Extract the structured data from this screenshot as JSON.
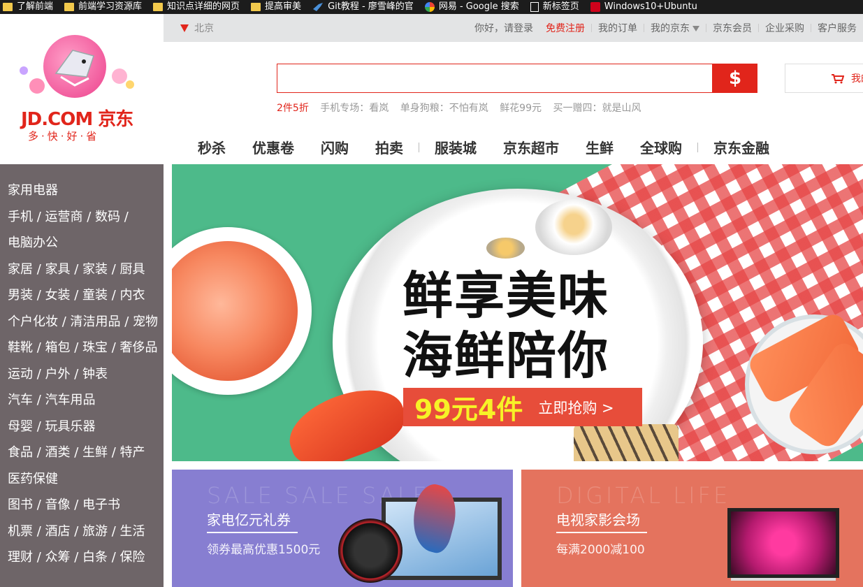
{
  "bookmarks": [
    {
      "label": "了解前端",
      "icon": "folder-icon"
    },
    {
      "label": "前端学习资源库",
      "icon": "folder-icon"
    },
    {
      "label": "知识点详细的网页",
      "icon": "folder-icon"
    },
    {
      "label": "提高审美",
      "icon": "folder-icon"
    },
    {
      "label": "Git教程 - 廖雪峰的官",
      "icon": "bird-icon"
    },
    {
      "label": "网易 - Google 搜索",
      "icon": "google-icon"
    },
    {
      "label": "新标签页",
      "icon": "page-icon"
    },
    {
      "label": "Windows10+Ubuntu",
      "icon": "bookmark-icon"
    }
  ],
  "logo": {
    "brand": "JD.COM 京东",
    "slogan": "多·快·好·省"
  },
  "topbar": {
    "location": "北京",
    "greeting": "你好，请登录",
    "register": "免费注册",
    "orders": "我的订单",
    "my_jd": "我的京东",
    "member": "京东会员",
    "enterprise": "企业采购",
    "service": "客户服务"
  },
  "search": {
    "value": "",
    "button_label": "$"
  },
  "cart": {
    "label": "我的购物车"
  },
  "hotwords": [
    "2件5折",
    "手机专场：看岚",
    "单身狗粮：不怕有岚",
    "鲜花99元",
    "买一赠四：就是山风"
  ],
  "mainnav": [
    "秒杀",
    "优惠卷",
    "闪购",
    "拍卖",
    "服装城",
    "京东超市",
    "生鲜",
    "全球购",
    "京东金融"
  ],
  "categories": [
    "家用电器",
    "手机 / 运营商 / 数码 /",
    "电脑办公",
    "家居 / 家具 / 家装 / 厨具",
    "男装 / 女装 / 童装 / 内衣",
    "个户化妆 / 清洁用品 / 宠物",
    "鞋靴 / 箱包 / 珠宝 / 奢侈品",
    "运动 / 户外 / 钟表",
    "汽车 / 汽车用品",
    "母婴 / 玩具乐器",
    "食品 / 酒类 / 生鲜 / 特产",
    "医药保健",
    "图书 / 音像 / 电子书",
    "机票 / 酒店 / 旅游 / 生活",
    "理财 / 众筹 / 白条 / 保险"
  ],
  "banner": {
    "line1": "鲜享美味",
    "line2": "海鲜陪你",
    "price": "99元4件",
    "cta": "立即抢购 >"
  },
  "promos": [
    {
      "ghost": "SALE SALE SALE",
      "title": "家电亿元礼券",
      "sub": "领券最高优惠1500元",
      "color": "#877ed1"
    },
    {
      "ghost": "DIGITAL LIFE",
      "title": "电视家影会场",
      "sub": "每满2000减100",
      "color": "#e4735e"
    }
  ],
  "colors": {
    "accent": "#e1251b",
    "menu_bg": "#6e6568",
    "topbar_bg": "#e3e4e5"
  }
}
